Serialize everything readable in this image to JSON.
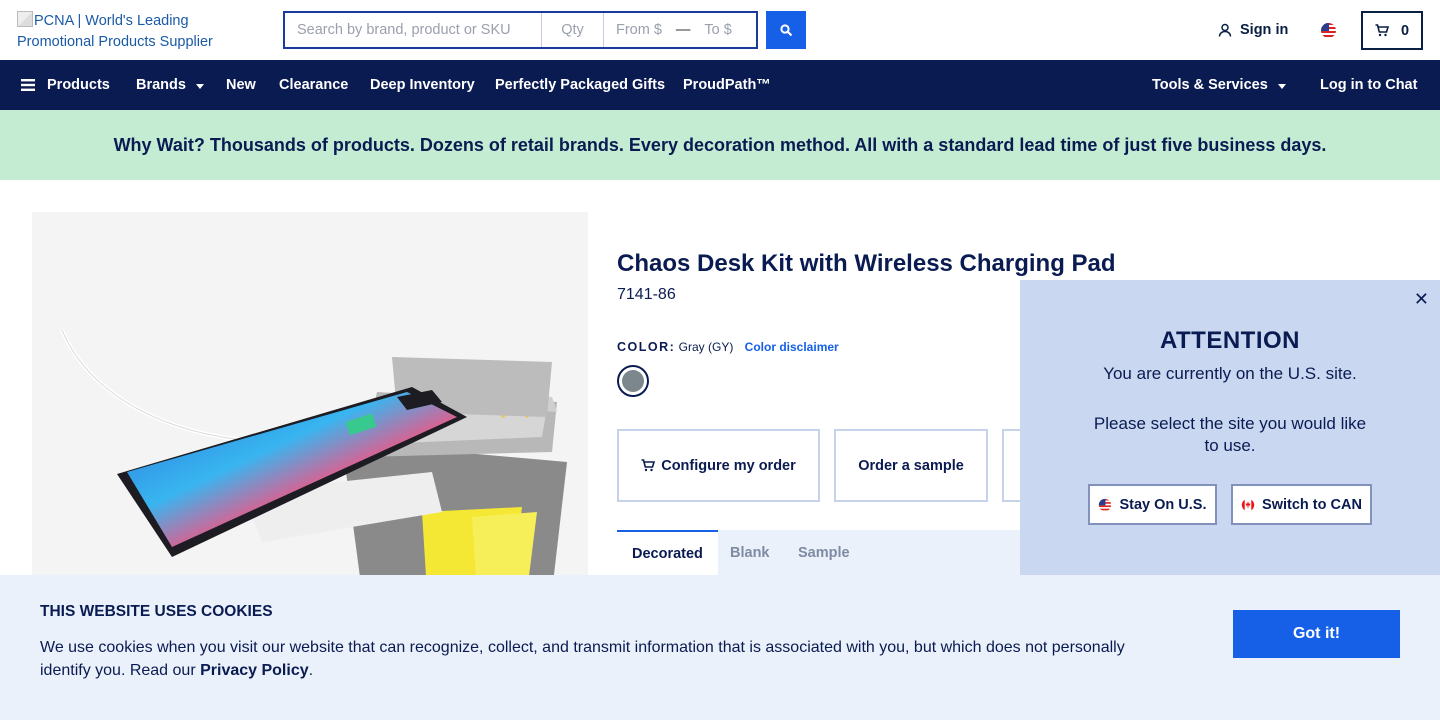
{
  "header": {
    "logo_alt": "PCNA | World's Leading Promotional Products Supplier",
    "search_placeholder": "Search by brand, product or SKU",
    "qty_placeholder": "Qty",
    "price_from_placeholder": "From $",
    "price_to_placeholder": "To $",
    "price_separator": "—",
    "signin_label": "Sign in",
    "cart_count": "0"
  },
  "nav": {
    "products": "Products",
    "brands": "Brands",
    "new": "New",
    "clearance": "Clearance",
    "deep_inventory": "Deep Inventory",
    "perfectly_packaged": "Perfectly Packaged Gifts",
    "proudpath": "ProudPath™",
    "tools": "Tools & Services",
    "chat": "Log in to Chat"
  },
  "promo": {
    "text": "Why Wait? Thousands of products. Dozens of retail brands. Every decoration method. All with a standard lead time of just five business days."
  },
  "product": {
    "title": "Chaos Desk Kit with Wireless Charging Pad",
    "sku": "7141-86",
    "color_label": "COLOR:",
    "color_value": "Gray (GY)",
    "color_disclaimer": "Color disclaimer",
    "swatch_color": "#7b868d",
    "configure_label": "Configure my order",
    "sample_label": "Order a sample",
    "tabs": [
      "Decorated",
      "Blank",
      "Sample"
    ]
  },
  "attention": {
    "title": "ATTENTION",
    "line1": "You are currently on the U.S. site.",
    "line2": "Please select the site you would like to use.",
    "stay_label": "Stay On U.S.",
    "switch_label": "Switch to CAN"
  },
  "cookies": {
    "title": "THIS WEBSITE USES COOKIES",
    "text": "We use cookies when you visit our website that can recognize, collect, and transmit information that is associated with you, but which does not personally identify you. Read our ",
    "link": "Privacy Policy",
    "period": ".",
    "button": "Got it!"
  },
  "colors": {
    "navy": "#0a1b52",
    "accent_blue": "#1660e8",
    "promo_green": "#c4ecd3",
    "modal_bg": "#c9d7f0",
    "cookie_bg": "#eaf1fa"
  }
}
